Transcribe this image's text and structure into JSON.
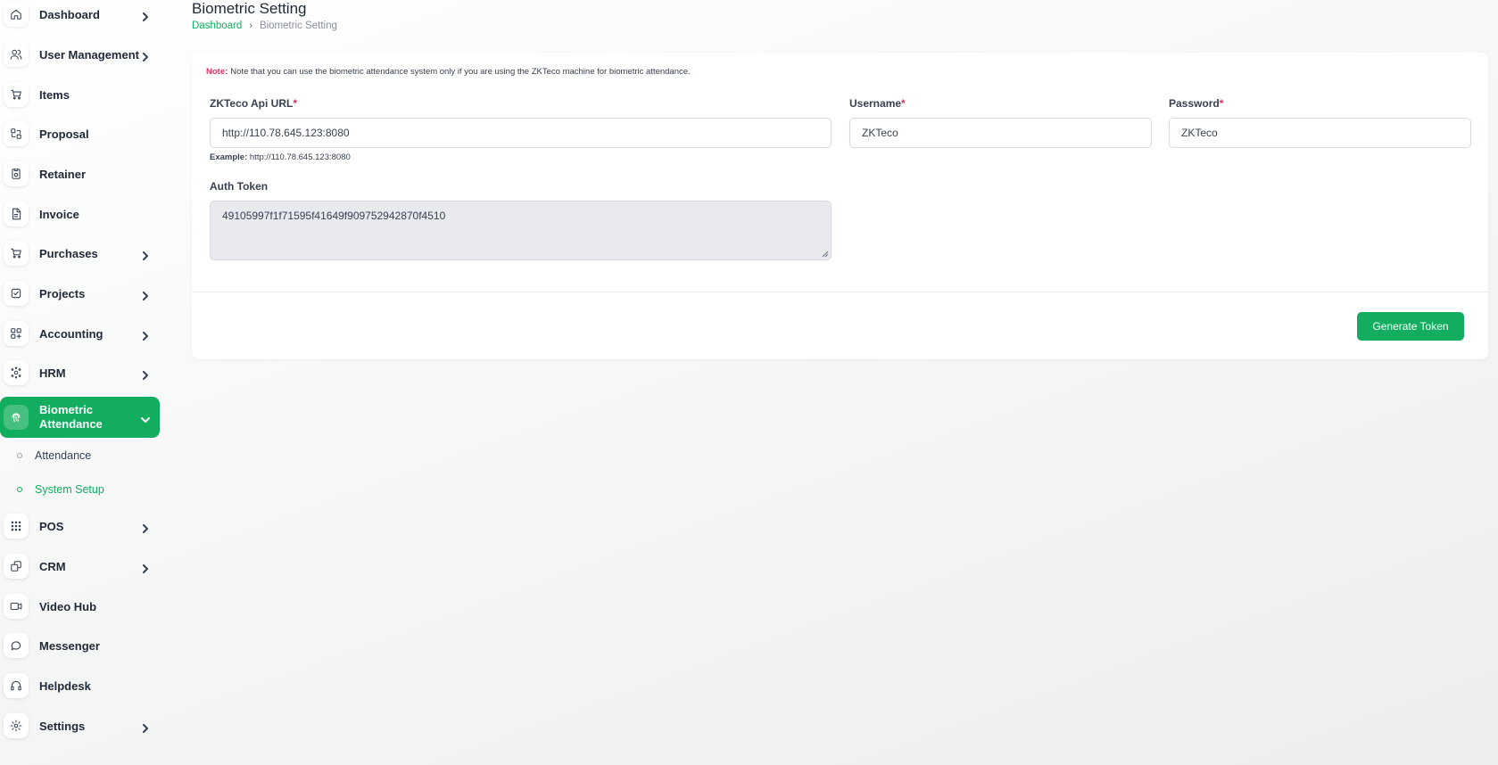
{
  "sidebar": {
    "items": [
      {
        "label": "Dashboard",
        "icon": "home-icon"
      },
      {
        "label": "User Management",
        "icon": "users-icon"
      },
      {
        "label": "Items",
        "icon": "cart-icon"
      },
      {
        "label": "Proposal",
        "icon": "proposal-icon"
      },
      {
        "label": "Retainer",
        "icon": "retainer-icon"
      },
      {
        "label": "Invoice",
        "icon": "invoice-icon"
      },
      {
        "label": "Purchases",
        "icon": "cart-icon"
      },
      {
        "label": "Projects",
        "icon": "check-square-icon"
      },
      {
        "label": "Accounting",
        "icon": "grid-icon"
      },
      {
        "label": "HRM",
        "icon": "hrm-icon"
      },
      {
        "label": "Biometric Attendance",
        "icon": "fingerprint-icon"
      },
      {
        "label": "POS",
        "icon": "dots-grid-icon"
      },
      {
        "label": "CRM",
        "icon": "layers-icon"
      },
      {
        "label": "Video Hub",
        "icon": "video-icon"
      },
      {
        "label": "Messenger",
        "icon": "chat-icon"
      },
      {
        "label": "Helpdesk",
        "icon": "headset-icon"
      },
      {
        "label": "Settings",
        "icon": "gear-icon"
      }
    ],
    "sub_items": [
      {
        "label": "Attendance"
      },
      {
        "label": "System Setup"
      }
    ]
  },
  "header": {
    "title": "Biometric Setting",
    "breadcrumb": {
      "home": "Dashboard",
      "separator": "›",
      "current": "Biometric Setting"
    }
  },
  "form": {
    "note_label": "Note:",
    "note_text": "Note that you can use the biometric attendance system only if you are using the ZKTeco machine for biometric attendance.",
    "api_url_label": "ZKTeco Api URL",
    "api_url_value": "http://110.78.645.123:8080",
    "example_label": "Example:",
    "example_value": "http://110.78.645.123:8080",
    "username_label": "Username",
    "username_value": "ZKTeco",
    "password_label": "Password",
    "password_value": "ZKTeco",
    "required_mark": "*",
    "auth_token_label": "Auth Token",
    "auth_token_value": "49105997f1f71595f41649f909752942870f4510",
    "generate_button": "Generate Token"
  },
  "colors": {
    "accent": "#12ad5e",
    "required": "#e0305c"
  }
}
